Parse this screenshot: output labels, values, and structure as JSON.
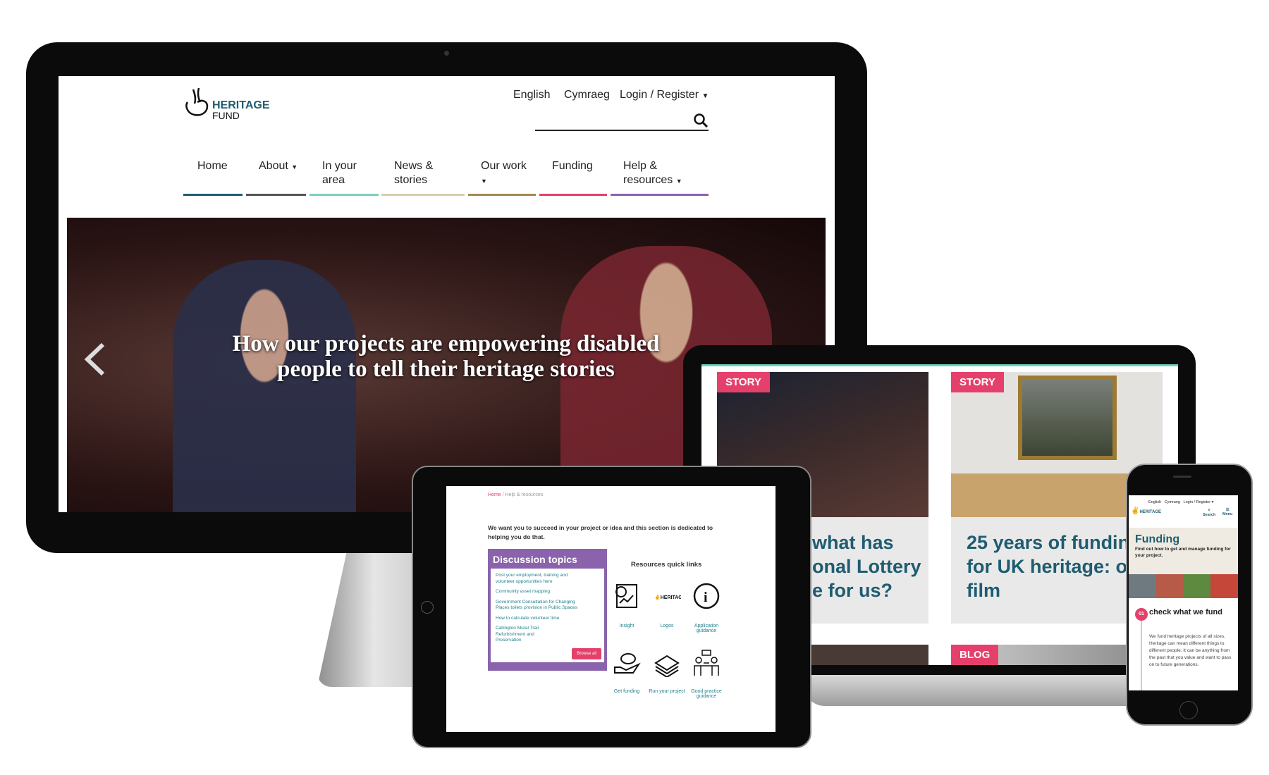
{
  "desktop": {
    "logo": {
      "line1": "HERITAGE",
      "line2": "FUND"
    },
    "top_links": [
      "English",
      "Cymraeg",
      "Login / Register"
    ],
    "nav": [
      {
        "label": "Home",
        "caret": false,
        "color": "#1f5c70"
      },
      {
        "label": "About",
        "caret": true,
        "color": "#555555"
      },
      {
        "label": "In your area",
        "caret": false,
        "color": "#7ccfc0"
      },
      {
        "label": "News & stories",
        "caret": false,
        "color": "#d8ccae"
      },
      {
        "label": "Our work",
        "caret": true,
        "color": "#a08a4f"
      },
      {
        "label": "Funding",
        "caret": false,
        "color": "#e4406b"
      },
      {
        "label": "Help & resources",
        "caret": true,
        "color": "#8a63ac"
      }
    ],
    "hero_title": "How our projects are empowering disabled people to tell their heritage stories"
  },
  "laptop": {
    "cards": [
      {
        "tag": "STORY",
        "title": "what has onal Lottery e for us?"
      },
      {
        "tag": "STORY",
        "title": "25 years of funding for UK heritage: our film"
      }
    ],
    "blog_tag": "BLOG"
  },
  "tablet": {
    "breadcrumb": [
      "Home",
      "Help & resources"
    ],
    "intro": "We want you to succeed in your project or idea and this section is dedicated to helping you do that.",
    "discussion": {
      "title": "Discussion topics",
      "items": [
        "Post your employment, training and volunteer opportunities here",
        "Community asset mapping",
        "Government Consultation for Changing Places toilets provision in Public Spaces",
        "How to calculate volunteer time",
        "Callington Mural Trail Refurbishment and Preservation"
      ],
      "button": "Browse all"
    },
    "quick_links": {
      "title": "Resources quick links",
      "items": [
        {
          "label": "Insight",
          "icon": "report-chart-icon"
        },
        {
          "label": "Logos",
          "icon": "heritage-logo-icon"
        },
        {
          "label": "Application guidance",
          "icon": "info-icon"
        },
        {
          "label": "Get funding",
          "icon": "piggy-bank-hand-icon"
        },
        {
          "label": "Run your project",
          "icon": "money-stack-icon"
        },
        {
          "label": "Good practice guidance",
          "icon": "meeting-icon"
        }
      ]
    }
  },
  "phone": {
    "top_links": [
      "English",
      "Cymraeg",
      "Login / Register"
    ],
    "search": "Search",
    "menu": "Menu",
    "title": "Funding",
    "subtitle": "Find out how to get and manage funding for your project.",
    "step": {
      "number": "01",
      "title": "check what we fund",
      "body": "We fund heritage projects of all sizes. Heritage can mean different things to different people. It can be anything from the past that you value and want to pass on to future generations."
    }
  },
  "colors": {
    "teal": "#1f5c70",
    "pink": "#e4406b",
    "purple": "#8a63ac"
  }
}
